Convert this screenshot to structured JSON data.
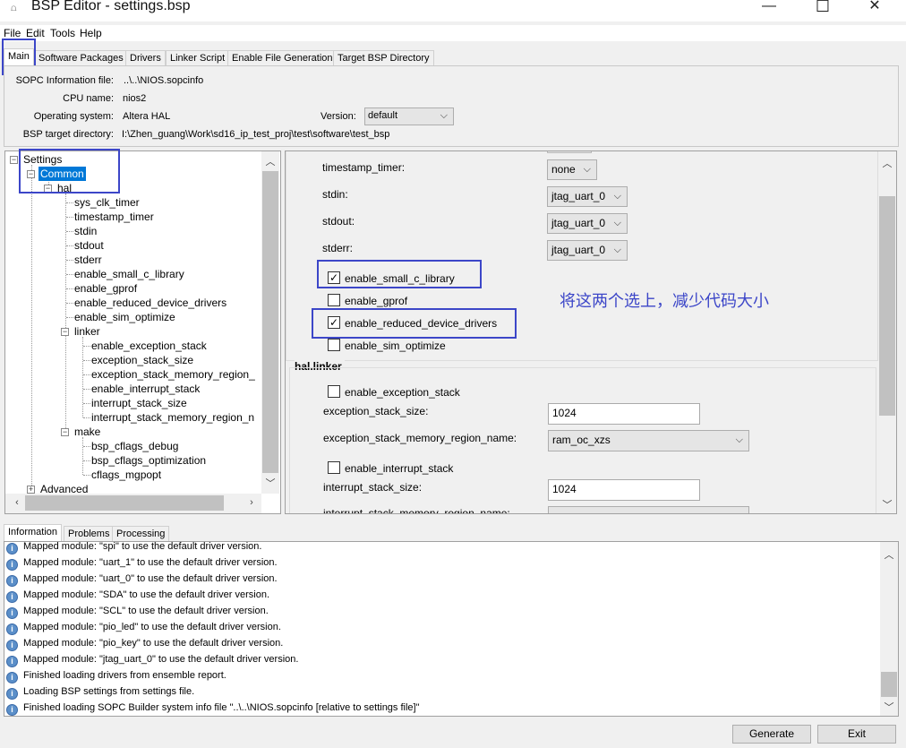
{
  "window": {
    "title": "BSP Editor - settings.bsp",
    "minimize": "—",
    "maximize": "☐",
    "close": "✕"
  },
  "menu": [
    "File",
    "Edit",
    "Tools",
    "Help"
  ],
  "tabs": [
    "Main",
    "Software Packages",
    "Drivers",
    "Linker Script",
    "Enable File Generation",
    "Target BSP Directory"
  ],
  "main": {
    "sopc_label": "SOPC Information file:",
    "sopc_value": "..\\..\\NIOS.sopcinfo",
    "cpu_label": "CPU name:",
    "cpu_value": "nios2",
    "os_label": "Operating system:",
    "os_value": "Altera HAL",
    "version_label": "Version:",
    "version_value": "default",
    "dir_label": "BSP target directory:",
    "dir_value": "I:\\Zhen_guang\\Work\\sd16_ip_test_proj\\test\\software\\test_bsp"
  },
  "tree": {
    "settings": "Settings",
    "common": "Common",
    "hal": "hal",
    "hal_items": [
      "sys_clk_timer",
      "timestamp_timer",
      "stdin",
      "stdout",
      "stderr",
      "enable_small_c_library",
      "enable_gprof",
      "enable_reduced_device_drivers",
      "enable_sim_optimize"
    ],
    "linker": "linker",
    "linker_items": [
      "enable_exception_stack",
      "exception_stack_size",
      "exception_stack_memory_region_",
      "enable_interrupt_stack",
      "interrupt_stack_size",
      "interrupt_stack_memory_region_n"
    ],
    "make": "make",
    "make_items": [
      "bsp_cflags_debug",
      "bsp_cflags_optimization",
      "cflags_mgpopt"
    ],
    "advanced": "Advanced"
  },
  "settings": {
    "timestamp_timer": {
      "label": "timestamp_timer:",
      "value": "none"
    },
    "stdin": {
      "label": "stdin:",
      "value": "jtag_uart_0"
    },
    "stdout": {
      "label": "stdout:",
      "value": "jtag_uart_0"
    },
    "stderr": {
      "label": "stderr:",
      "value": "jtag_uart_0"
    },
    "checks": [
      {
        "label": "enable_small_c_library",
        "checked": true
      },
      {
        "label": "enable_gprof",
        "checked": false
      },
      {
        "label": "enable_reduced_device_drivers",
        "checked": true
      },
      {
        "label": "enable_sim_optimize",
        "checked": false
      }
    ],
    "linker_group": "hal.linker",
    "enable_exception_stack": "enable_exception_stack",
    "exception_stack_size": {
      "label": "exception_stack_size:",
      "value": "1024"
    },
    "exception_region": {
      "label": "exception_stack_memory_region_name:",
      "value": "ram_oc_xzs"
    },
    "enable_interrupt_stack": "enable_interrupt_stack",
    "interrupt_stack_size": {
      "label": "interrupt_stack_size:",
      "value": "1024"
    },
    "interrupt_region": {
      "label": "interrupt_stack_memory_region_name:"
    }
  },
  "annotation": "将这两个选上，减少代码大小",
  "annotation_color": "#3c46c8",
  "bottom_tabs": [
    "Information",
    "Problems",
    "Processing"
  ],
  "log": [
    "Mapped module: \"spi\" to use the default driver version.",
    "Mapped module: \"uart_1\" to use the default driver version.",
    "Mapped module: \"uart_0\" to use the default driver version.",
    "Mapped module: \"SDA\" to use the default driver version.",
    "Mapped module: \"SCL\" to use the default driver version.",
    "Mapped module: \"pio_led\" to use the default driver version.",
    "Mapped module: \"pio_key\" to use the default driver version.",
    "Mapped module: \"jtag_uart_0\" to use the default driver version.",
    "Finished loading drivers from ensemble report.",
    "Loading BSP settings from settings file.",
    "Finished loading SOPC Builder system info file \"..\\..\\NIOS.sopcinfo [relative to settings file]\""
  ],
  "buttons": {
    "generate": "Generate",
    "exit": "Exit"
  }
}
